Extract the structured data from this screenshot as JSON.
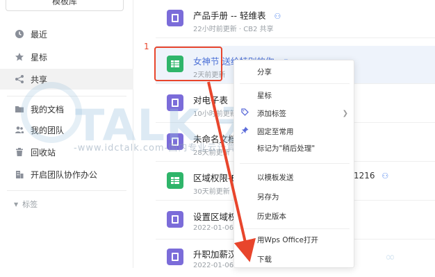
{
  "sidebar": {
    "template_button": "模板库",
    "items": [
      {
        "label": "最近",
        "icon": "clock-icon"
      },
      {
        "label": "星标",
        "icon": "star-icon"
      },
      {
        "label": "共享",
        "icon": "share-icon"
      },
      {
        "label": "我的文档",
        "icon": "folder-icon"
      },
      {
        "label": "我的团队",
        "icon": "team-icon"
      },
      {
        "label": "回收站",
        "icon": "trash-icon"
      },
      {
        "label": "开启团队协作办公",
        "icon": "building-icon"
      }
    ],
    "tags_label": "标签"
  },
  "files": [
    {
      "name": "产品手册 -- 轻维表",
      "meta": "22小时前更新 · CB2 共享",
      "type": "doc",
      "shared": true
    },
    {
      "name": "女神节 送给特别的你",
      "meta": "2天前更新",
      "type": "sheet",
      "shared": true
    },
    {
      "name": "对电子表",
      "meta": "10小时前更新",
      "type": "doc",
      "shared": false
    },
    {
      "name": "未命名文档",
      "meta": "28天前更新",
      "type": "doc",
      "shared": false
    },
    {
      "name": "区域权限-E",
      "meta": "30天前更新",
      "type": "sheet",
      "shared": false,
      "trail": "1216"
    },
    {
      "name": "设置区域权",
      "meta": "2022-01-06",
      "type": "doc",
      "shared": false
    },
    {
      "name": "升职加薪汉",
      "meta": "2022-01-06",
      "type": "doc",
      "shared": false
    }
  ],
  "step_number": "1",
  "context_menu": {
    "items": [
      {
        "label": "分享"
      },
      {
        "label": "星标"
      },
      {
        "label": "添加标签",
        "icon": "tag-icon",
        "submenu": true
      },
      {
        "label": "固定至常用",
        "icon": "pin-icon"
      },
      {
        "label": "标记为\"稍后处理\""
      },
      {
        "label": "以模板发送"
      },
      {
        "label": "另存为"
      },
      {
        "label": "历史版本"
      },
      {
        "label": "用Wps Office打开"
      },
      {
        "label": "下载"
      }
    ]
  },
  "watermark": {
    "big": "TALK 云说",
    "small": "-www.idctalk.com-国内专业云计算交流服务平台-"
  },
  "colors": {
    "accent_red": "#e8452c",
    "doc_purple": "#7b6cd9",
    "sheet_green": "#2fb56a",
    "share_blue": "#5b8def"
  }
}
